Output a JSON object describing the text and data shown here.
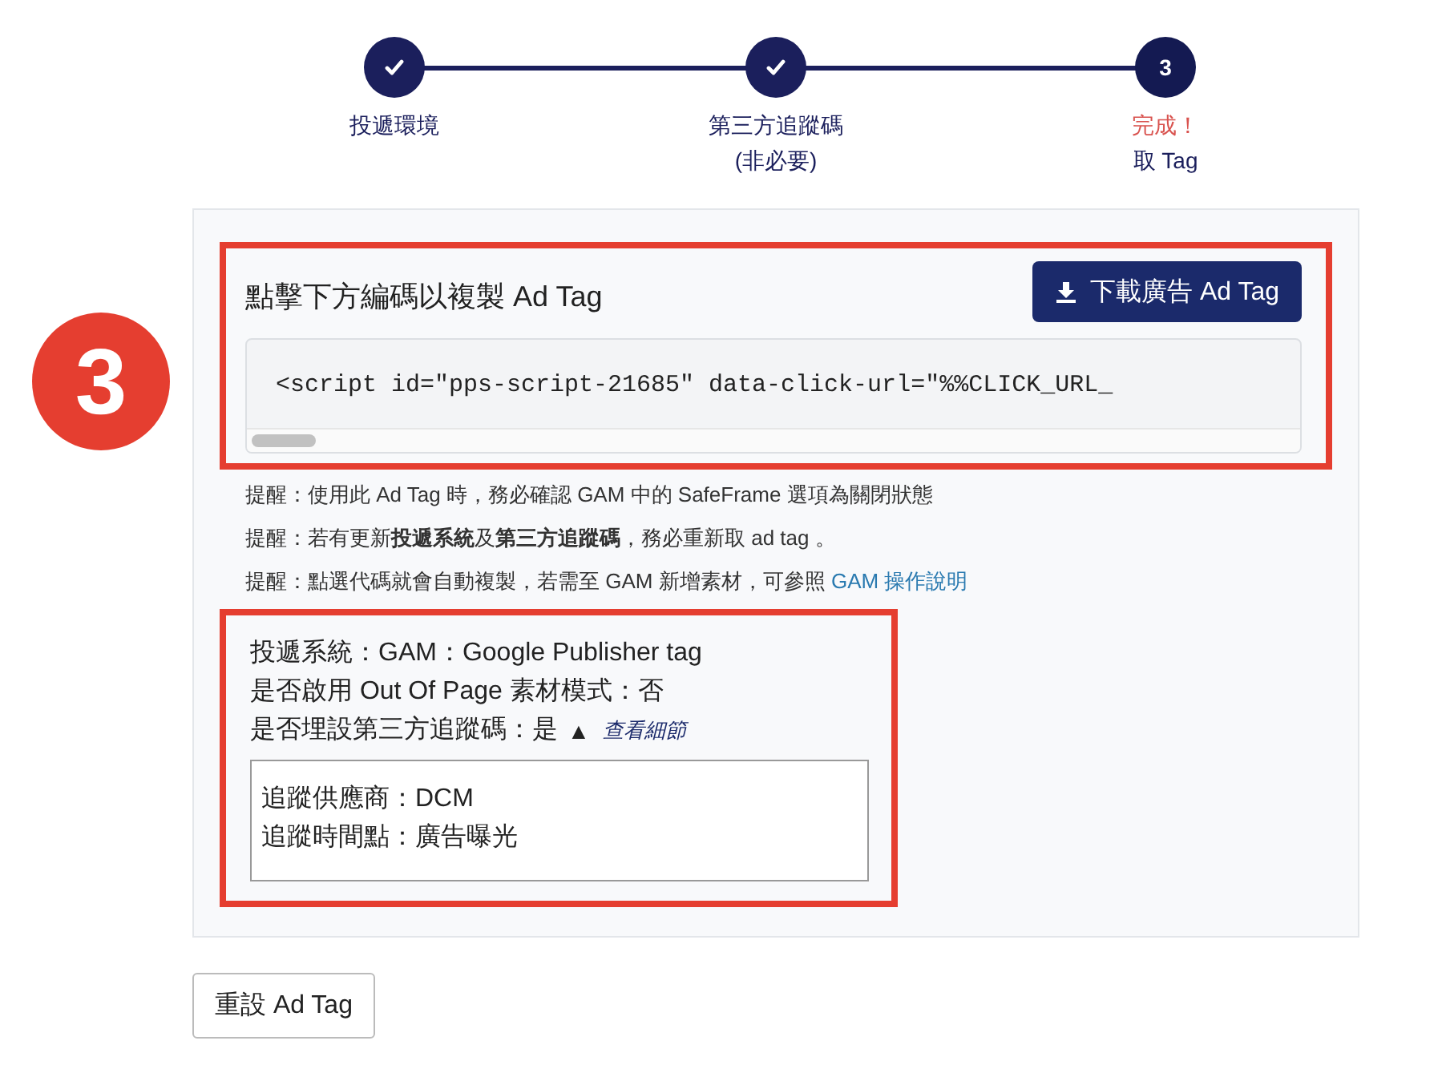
{
  "steps": [
    {
      "done": true,
      "lines": [
        {
          "text": "投遞環境",
          "accent": false
        }
      ]
    },
    {
      "done": true,
      "lines": [
        {
          "text": "第三方追蹤碼",
          "accent": false
        },
        {
          "text": "(非必要)",
          "accent": false
        }
      ]
    },
    {
      "done": false,
      "number": "3",
      "lines": [
        {
          "text": "完成！",
          "accent": true
        },
        {
          "text": "取 Tag",
          "accent": false
        }
      ]
    }
  ],
  "annotation": {
    "label": "3"
  },
  "tag_section": {
    "title": "點擊下方編碼以複製 Ad Tag",
    "download_button": "下載廣告 Ad Tag",
    "code": "<script id=\"pps-script-21685\" data-click-url=\"%%CLICK_URL_"
  },
  "notes": [
    {
      "text": "提醒：使用此 Ad Tag 時，務必確認 GAM 中的 SafeFrame 選項為關閉狀態"
    },
    {
      "text": "提醒：若有更新**投遞系統**及**第三方追蹤碼**，務必重新取 ad tag 。"
    },
    {
      "text": "提醒：點選代碼就會自動複製，若需至 GAM 新增素材，可參照",
      "link": "GAM 操作說明"
    }
  ],
  "summary": {
    "lines": [
      "投遞系統：GAM：Google Publisher tag",
      "是否啟用 Out Of Page 素材模式：否"
    ],
    "tracking": {
      "label": "是否埋設第三方追蹤碼：是",
      "toggle": "▲",
      "link": "查看細節",
      "expanded": true,
      "details": [
        "追蹤供應商：DCM",
        "追蹤時間點：廣告曝光"
      ]
    }
  },
  "reset_button": "重設 Ad Tag"
}
